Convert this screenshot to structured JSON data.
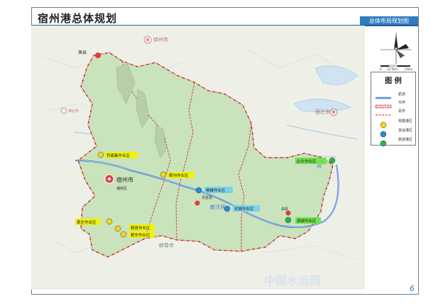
{
  "header": {
    "title": "宿州港总体规划",
    "subtitle": "总体布局规划图"
  },
  "legend": {
    "title": "图  例",
    "items": [
      {
        "label": "航道",
        "symbol": "waterway-line",
        "color": "#2e6bd6"
      },
      {
        "label": "市界",
        "symbol": "city-boundary",
        "color": "#cc2222"
      },
      {
        "label": "县界",
        "symbol": "county-boundary",
        "color": "#cc2222"
      },
      {
        "label": "规模港区",
        "symbol": "port-marker-yellow",
        "color": "#f2d51c"
      },
      {
        "label": "货运港区",
        "symbol": "port-marker-blue",
        "color": "#1e90d6"
      },
      {
        "label": "旅游港区",
        "symbol": "port-marker-green",
        "color": "#2bb44c"
      }
    ]
  },
  "scale": {
    "labels": [
      "0",
      "12.5km",
      "25km"
    ]
  },
  "cities": [
    {
      "name": "萧县"
    },
    {
      "name": "徐州市"
    },
    {
      "name": "淮北市"
    },
    {
      "name": "宿迁市"
    },
    {
      "name": "宿州市"
    },
    {
      "name": "埇桥区"
    },
    {
      "name": "灵璧县"
    },
    {
      "name": "泗县"
    },
    {
      "name": "蚌埠市"
    }
  ],
  "port_areas": [
    {
      "name": "符离集作业区"
    },
    {
      "name": "蕲沟作业区"
    },
    {
      "name": "杨楼作业区"
    },
    {
      "name": "灵城作业区"
    },
    {
      "name": "山头作业区"
    },
    {
      "name": "泗城作业区"
    },
    {
      "name": "莱庄作业区"
    },
    {
      "name": "蕲县作业区"
    },
    {
      "name": "蕲东作业区"
    }
  ],
  "water": {
    "river_label": "河",
    "canal_label": "新汴河"
  },
  "page_number": "6",
  "watermark": "中国水运网",
  "colors": {
    "land": "#eef0e8",
    "region_fill": "#c9e3bc",
    "boundary": "#cc2222",
    "waterway": "#2e6bd6",
    "highlight_label": "#f2f20a",
    "green_label": "#6fe24c"
  }
}
